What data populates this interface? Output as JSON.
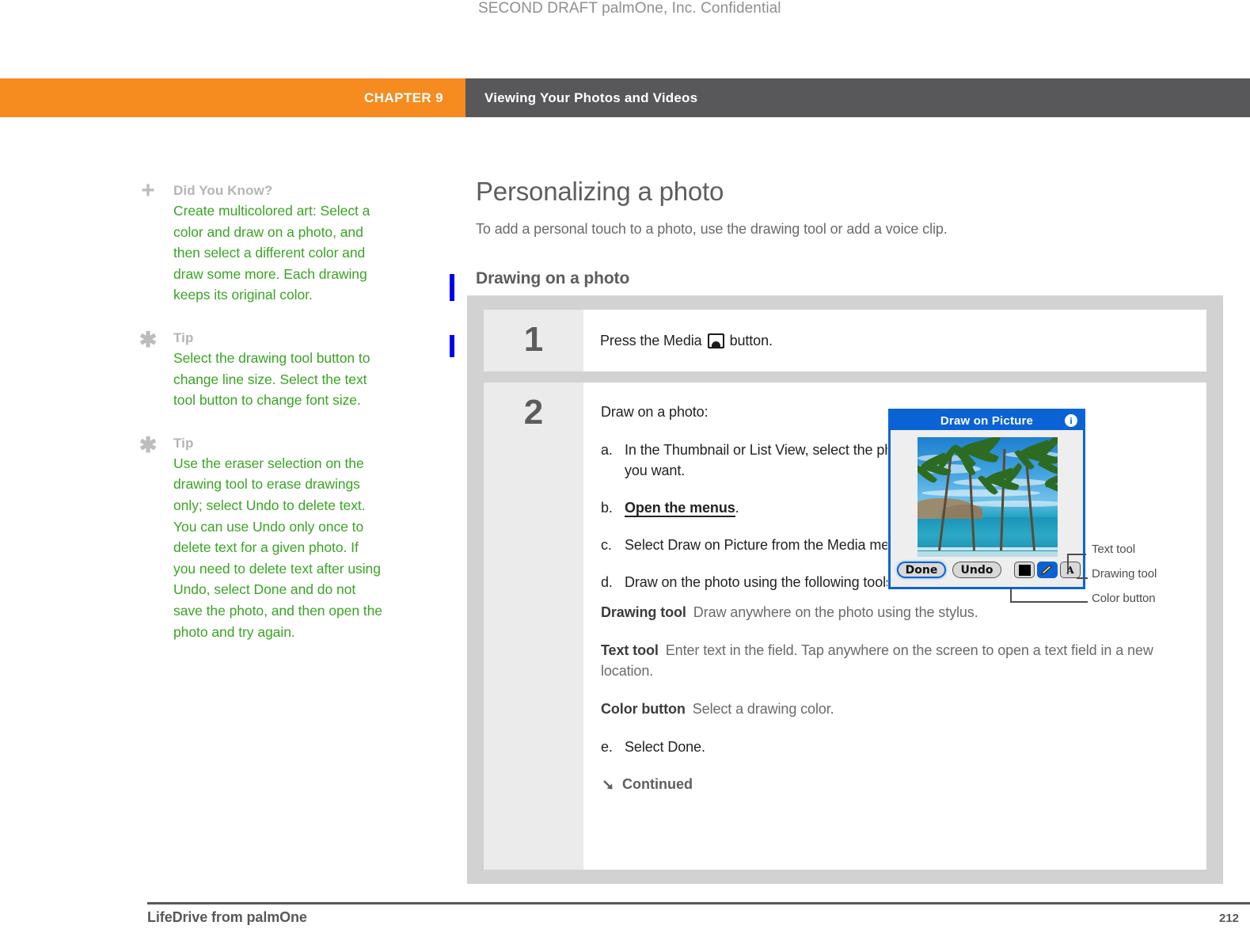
{
  "draft_stamp": "SECOND DRAFT palmOne, Inc.  Confidential",
  "colors": {
    "chapter_orange": "#f68b1f",
    "header_dark": "#58585a",
    "tip_green": "#3aa425",
    "tip_label_gray": "#b5b5b5",
    "change_bar_blue": "#0000f0",
    "device_blue": "#0a63d5"
  },
  "header": {
    "chapter_label": "CHAPTER 9",
    "title": "Viewing Your Photos and Videos"
  },
  "sidebar": {
    "items": [
      {
        "icon": "plus-icon",
        "heading": "Did You Know?",
        "body": "Create multicolored art: Select a color and draw on a photo, and then select a different color and draw some more. Each drawing keeps its original color."
      },
      {
        "icon": "asterisk-icon",
        "heading": "Tip",
        "body": "Select the drawing tool button to change line size. Select the text tool button to change font size."
      },
      {
        "icon": "asterisk-icon",
        "heading": "Tip",
        "body": "Use the eraser selection on the drawing tool to erase drawings only; select Undo to delete text. You can use Undo only once to delete text for a given photo. If you need to delete text after using Undo, select Done and do not save the photo, and then open the photo and try again."
      }
    ]
  },
  "main": {
    "page_title": "Personalizing a photo",
    "intro": "To add a personal touch to a photo, use the drawing tool or add a voice clip.",
    "section_heading": "Drawing on a photo",
    "steps": [
      {
        "number": "1",
        "text_before_icon": "Press the Media",
        "icon": "media-button-icon",
        "text_after_icon": "button."
      },
      {
        "number": "2",
        "lead": "Draw on a photo:",
        "substeps": [
          {
            "marker": "a.",
            "text": "In the Thumbnail or List View, select the photo you want."
          },
          {
            "marker": "b.",
            "text_bold": "Open the menus",
            "text_tail": "."
          },
          {
            "marker": "c.",
            "text": "Select Draw on Picture from the Media menu."
          },
          {
            "marker": "d.",
            "text": "Draw on the photo using the following tools:"
          }
        ],
        "tools": [
          {
            "term": "Drawing tool",
            "desc": "Draw anywhere on the photo using the stylus."
          },
          {
            "term": "Text tool",
            "desc": "Enter text in the field. Tap anywhere on the screen to open a text field in a new location."
          },
          {
            "term": "Color button",
            "desc": "Select a drawing color."
          }
        ],
        "final_substep": {
          "marker": "e.",
          "text": "Select Done."
        },
        "continued": "Continued"
      }
    ]
  },
  "device": {
    "title": "Draw on Picture",
    "info_icon": "info-icon",
    "photo_alt": "palm trees on a tropical beach",
    "buttons": [
      {
        "name": "done-button",
        "label": "Done"
      },
      {
        "name": "undo-button",
        "label": "Undo"
      }
    ],
    "tools": [
      {
        "name": "color-button",
        "label": ""
      },
      {
        "name": "drawing-tool-button",
        "label": ""
      },
      {
        "name": "text-tool-button",
        "label": "A"
      }
    ]
  },
  "callouts": [
    {
      "label": "Text tool"
    },
    {
      "label": "Drawing tool"
    },
    {
      "label": "Color button"
    }
  ],
  "footer": {
    "left": "LifeDrive from palmOne",
    "page_number": "212"
  }
}
